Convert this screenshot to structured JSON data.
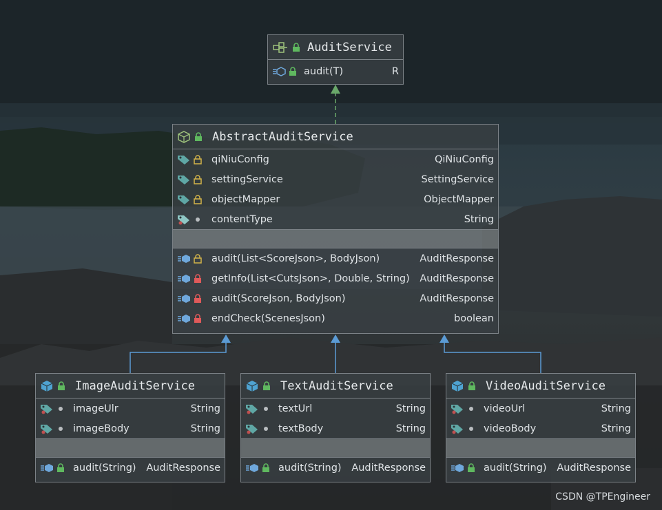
{
  "interface": {
    "name": "AuditService",
    "methods": [
      {
        "name": "audit(T)",
        "type": "R"
      }
    ]
  },
  "abstract_class": {
    "name": "AbstractAuditService",
    "fields": [
      {
        "name": "qiNiuConfig",
        "type": "QiNiuConfig"
      },
      {
        "name": "settingService",
        "type": "SettingService"
      },
      {
        "name": "objectMapper",
        "type": "ObjectMapper"
      },
      {
        "name": "contentType",
        "type": "String"
      }
    ],
    "methods": [
      {
        "name": "audit(List<ScoreJson>, BodyJson)",
        "type": "AuditResponse"
      },
      {
        "name": "getInfo(List<CutsJson>, Double, String)",
        "type": "AuditResponse"
      },
      {
        "name": "audit(ScoreJson, BodyJson)",
        "type": "AuditResponse"
      },
      {
        "name": "endCheck(ScenesJson)",
        "type": "boolean"
      }
    ]
  },
  "subclasses": [
    {
      "name": "ImageAuditService",
      "fields": [
        {
          "name": "imageUlr",
          "type": "String"
        },
        {
          "name": "imageBody",
          "type": "String"
        }
      ],
      "methods": [
        {
          "name": "audit(String)",
          "type": "AuditResponse"
        }
      ]
    },
    {
      "name": "TextAuditService",
      "fields": [
        {
          "name": "textUrl",
          "type": "String"
        },
        {
          "name": "textBody",
          "type": "String"
        }
      ],
      "methods": [
        {
          "name": "audit(String)",
          "type": "AuditResponse"
        }
      ]
    },
    {
      "name": "VideoAuditService",
      "fields": [
        {
          "name": "videoUrl",
          "type": "String"
        },
        {
          "name": "videoBody",
          "type": "String"
        }
      ],
      "methods": [
        {
          "name": "audit(String)",
          "type": "AuditResponse"
        }
      ]
    }
  ],
  "watermark": "CSDN @TPEngineer",
  "colors": {
    "lock_public": "#5fb85f",
    "lock_protected": "#d4b44a",
    "lock_private": "#e05a5a",
    "inheritance_arrow": "#5b9bd5",
    "implements_arrow": "#6aa86a"
  }
}
